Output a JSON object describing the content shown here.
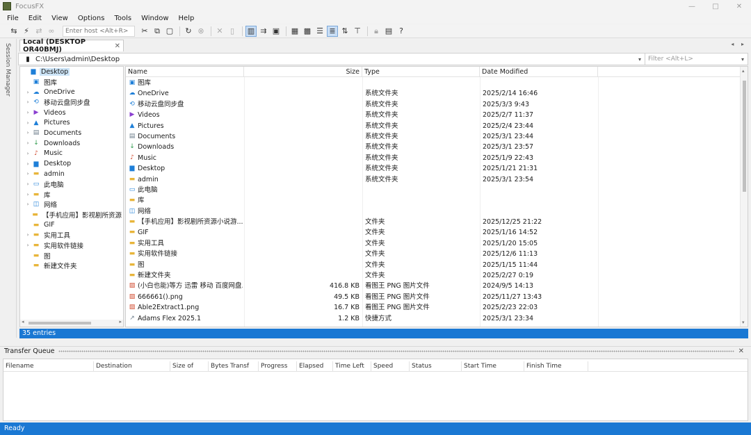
{
  "window": {
    "title": "FocusFX",
    "controls": [
      "—",
      "□",
      "✕"
    ]
  },
  "menu": [
    "File",
    "Edit",
    "View",
    "Options",
    "Tools",
    "Window",
    "Help"
  ],
  "toolbar": {
    "host_placeholder": "Enter host <Alt+R>"
  },
  "side_strip": {
    "label": "Session Manager"
  },
  "tab": {
    "label": "Local (DESKTOP OR40BMJ)",
    "close": "✕",
    "arrows": "◂ ▸"
  },
  "path": {
    "value": "C:\\Users\\admin\\Desktop",
    "filter_placeholder": "Filter <Alt+L>"
  },
  "tree": [
    {
      "label": "Desktop",
      "icon": "desktop-icon",
      "glyph": "▆",
      "color": "c-blue",
      "exp": "",
      "indent": 0,
      "selected": true
    },
    {
      "label": "图库",
      "icon": "gallery-icon",
      "glyph": "▣",
      "color": "c-blue",
      "exp": "",
      "indent": 1
    },
    {
      "label": "OneDrive",
      "icon": "cloud-icon",
      "glyph": "☁",
      "color": "c-blue",
      "exp": "›",
      "indent": 1
    },
    {
      "label": "移动云盘同步盘",
      "icon": "sync-drive-icon",
      "glyph": "⟲",
      "color": "c-blue",
      "exp": "›",
      "indent": 1
    },
    {
      "label": "Videos",
      "icon": "videos-icon",
      "glyph": "▶",
      "color": "c-purple",
      "exp": "›",
      "indent": 1
    },
    {
      "label": "Pictures",
      "icon": "pictures-icon",
      "glyph": "▲",
      "color": "c-blue",
      "exp": "›",
      "indent": 1
    },
    {
      "label": "Documents",
      "icon": "documents-icon",
      "glyph": "▤",
      "color": "c-grey",
      "exp": "›",
      "indent": 1
    },
    {
      "label": "Downloads",
      "icon": "downloads-icon",
      "glyph": "↓",
      "color": "c-green",
      "exp": "›",
      "indent": 1
    },
    {
      "label": "Music",
      "icon": "music-icon",
      "glyph": "♪",
      "color": "c-red",
      "exp": "›",
      "indent": 1
    },
    {
      "label": "Desktop",
      "icon": "desktop-icon",
      "glyph": "▆",
      "color": "c-blue",
      "exp": "›",
      "indent": 1
    },
    {
      "label": "admin",
      "icon": "folder-icon",
      "glyph": "▬",
      "color": "c-folder",
      "exp": "›",
      "indent": 1
    },
    {
      "label": "此电脑",
      "icon": "computer-icon",
      "glyph": "▭",
      "color": "c-blue",
      "exp": "›",
      "indent": 1
    },
    {
      "label": "库",
      "icon": "folder-icon",
      "glyph": "▬",
      "color": "c-folder",
      "exp": "›",
      "indent": 1
    },
    {
      "label": "网络",
      "icon": "network-icon",
      "glyph": "◫",
      "color": "c-blue",
      "exp": "›",
      "indent": 1
    },
    {
      "label": "【手机应用】影视剧所资源",
      "icon": "folder-icon",
      "glyph": "▬",
      "color": "c-folder",
      "exp": "",
      "indent": 1
    },
    {
      "label": "GIF",
      "icon": "folder-icon",
      "glyph": "▬",
      "color": "c-folder",
      "exp": "",
      "indent": 1
    },
    {
      "label": "实用工具",
      "icon": "folder-icon",
      "glyph": "▬",
      "color": "c-folder",
      "exp": "›",
      "indent": 1
    },
    {
      "label": "实用软件链接",
      "icon": "folder-icon",
      "glyph": "▬",
      "color": "c-folder",
      "exp": "›",
      "indent": 1
    },
    {
      "label": "图",
      "icon": "folder-icon",
      "glyph": "▬",
      "color": "c-folder",
      "exp": "",
      "indent": 1
    },
    {
      "label": "新建文件夹",
      "icon": "folder-icon",
      "glyph": "▬",
      "color": "c-folder",
      "exp": "",
      "indent": 1
    }
  ],
  "filelist": {
    "columns": {
      "name": "Name",
      "size": "Size",
      "type": "Type",
      "date": "Date Modified"
    },
    "rows": [
      {
        "name": "图库",
        "icon": "gallery-icon",
        "glyph": "▣",
        "color": "c-blue",
        "size": "",
        "type": "",
        "date": ""
      },
      {
        "name": "OneDrive",
        "icon": "cloud-icon",
        "glyph": "☁",
        "color": "c-blue",
        "size": "",
        "type": "系统文件夹",
        "date": "2025/2/14 16:46"
      },
      {
        "name": "移动云盘同步盘",
        "icon": "sync-drive-icon",
        "glyph": "⟲",
        "color": "c-blue",
        "size": "",
        "type": "系统文件夹",
        "date": "2025/3/3 9:43"
      },
      {
        "name": "Videos",
        "icon": "videos-icon",
        "glyph": "▶",
        "color": "c-purple",
        "size": "",
        "type": "系统文件夹",
        "date": "2025/2/7 11:37"
      },
      {
        "name": "Pictures",
        "icon": "pictures-icon",
        "glyph": "▲",
        "color": "c-blue",
        "size": "",
        "type": "系统文件夹",
        "date": "2025/2/4 23:44"
      },
      {
        "name": "Documents",
        "icon": "documents-icon",
        "glyph": "▤",
        "color": "c-grey",
        "size": "",
        "type": "系统文件夹",
        "date": "2025/3/1 23:44"
      },
      {
        "name": "Downloads",
        "icon": "downloads-icon",
        "glyph": "↓",
        "color": "c-green",
        "size": "",
        "type": "系统文件夹",
        "date": "2025/3/1 23:57"
      },
      {
        "name": "Music",
        "icon": "music-icon",
        "glyph": "♪",
        "color": "c-red",
        "size": "",
        "type": "系统文件夹",
        "date": "2025/1/9 22:43"
      },
      {
        "name": "Desktop",
        "icon": "desktop-icon",
        "glyph": "▆",
        "color": "c-blue",
        "size": "",
        "type": "系统文件夹",
        "date": "2025/1/21 21:31"
      },
      {
        "name": "admin",
        "icon": "folder-icon",
        "glyph": "▬",
        "color": "c-folder",
        "size": "",
        "type": "系统文件夹",
        "date": "2025/3/1 23:54"
      },
      {
        "name": "此电脑",
        "icon": "computer-icon",
        "glyph": "▭",
        "color": "c-blue",
        "size": "",
        "type": "",
        "date": ""
      },
      {
        "name": "库",
        "icon": "folder-icon",
        "glyph": "▬",
        "color": "c-folder",
        "size": "",
        "type": "",
        "date": ""
      },
      {
        "name": "网络",
        "icon": "network-icon",
        "glyph": "◫",
        "color": "c-blue",
        "size": "",
        "type": "",
        "date": ""
      },
      {
        "name": "【手机应用】影视剧所资源小说游...",
        "icon": "folder-icon",
        "glyph": "▬",
        "color": "c-folder",
        "size": "",
        "type": "文件夹",
        "date": "2025/12/25 21:22"
      },
      {
        "name": "GIF",
        "icon": "folder-icon",
        "glyph": "▬",
        "color": "c-folder",
        "size": "",
        "type": "文件夹",
        "date": "2025/1/16 14:52"
      },
      {
        "name": "实用工具",
        "icon": "folder-icon",
        "glyph": "▬",
        "color": "c-folder",
        "size": "",
        "type": "文件夹",
        "date": "2025/1/20 15:05"
      },
      {
        "name": "实用软件链接",
        "icon": "folder-icon",
        "glyph": "▬",
        "color": "c-folder",
        "size": "",
        "type": "文件夹",
        "date": "2025/12/6 11:13"
      },
      {
        "name": "图",
        "icon": "folder-icon",
        "glyph": "▬",
        "color": "c-folder",
        "size": "",
        "type": "文件夹",
        "date": "2025/1/15 11:44"
      },
      {
        "name": "新建文件夹",
        "icon": "folder-icon",
        "glyph": "▬",
        "color": "c-folder",
        "size": "",
        "type": "文件夹",
        "date": "2025/2/27 0:19"
      },
      {
        "name": "(小白也能)等方 迅雷 移动 百度网盘...",
        "icon": "png-file-icon",
        "glyph": "▨",
        "color": "c-red",
        "size": "416.8 KB",
        "type": "看图王 PNG 图片文件",
        "date": "2024/9/5 14:13"
      },
      {
        "name": "666661().png",
        "icon": "png-file-icon",
        "glyph": "▨",
        "color": "c-red",
        "size": "49.5 KB",
        "type": "看图王 PNG 图片文件",
        "date": "2025/11/27 13:43"
      },
      {
        "name": "Able2Extract1.png",
        "icon": "png-file-icon",
        "glyph": "▨",
        "color": "c-red",
        "size": "16.7 KB",
        "type": "看图王 PNG 图片文件",
        "date": "2025/2/23 22:03"
      },
      {
        "name": "Adams Flex 2025.1",
        "icon": "shortcut-icon",
        "glyph": "↗",
        "color": "c-grey",
        "size": "1.2 KB",
        "type": "快捷方式",
        "date": "2025/3/1 23:34"
      }
    ]
  },
  "status": {
    "entries": "35 entries"
  },
  "transfer_queue": {
    "title": "Transfer Queue",
    "close": "✕",
    "columns": [
      "Filename",
      "Destination",
      "Size of",
      "Bytes Transf",
      "Progress",
      "Elapsed",
      "Time Left",
      "Speed",
      "Status",
      "Start Time",
      "Finish Time"
    ]
  },
  "ready": "Ready"
}
